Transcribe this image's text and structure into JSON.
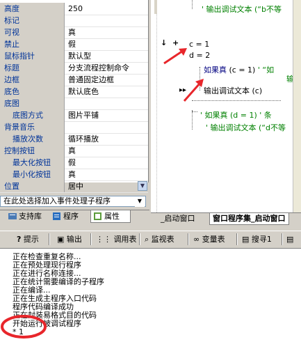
{
  "properties": [
    {
      "name": "高度",
      "value": "250",
      "sub": false
    },
    {
      "name": "标记",
      "value": "",
      "sub": false
    },
    {
      "name": "可视",
      "value": "真",
      "sub": false
    },
    {
      "name": "禁止",
      "value": "假",
      "sub": false
    },
    {
      "name": "鼠标指针",
      "value": "默认型",
      "sub": false
    },
    {
      "name": "标题",
      "value": "分支流程控制命令",
      "sub": false
    },
    {
      "name": "边框",
      "value": "普通固定边框",
      "sub": false
    },
    {
      "name": "底色",
      "value": "默认底色",
      "sub": false
    },
    {
      "name": "底图",
      "value": "",
      "sub": false
    },
    {
      "name": "底图方式",
      "value": "图片平铺",
      "sub": true
    },
    {
      "name": "背景音乐",
      "value": "",
      "sub": false
    },
    {
      "name": "播放次数",
      "value": "循环播放",
      "sub": true
    },
    {
      "name": "控制按钮",
      "value": "真",
      "sub": false
    },
    {
      "name": "最大化按钮",
      "value": "假",
      "sub": true
    },
    {
      "name": "最小化按钮",
      "value": "真",
      "sub": true
    },
    {
      "name": "位置",
      "value": "居中",
      "sub": false
    }
  ],
  "event_select": "在此处选择加入事件处理子程序",
  "left_tabs": [
    "支持库",
    "程序",
    "属性"
  ],
  "code": {
    "line_top": "' 输出调试文本 (“b不等",
    "line_c": "c = 1",
    "line_d": "d = 2",
    "if_kw": "如果真",
    "if_cond": "(c = 1)",
    "if_comment": "' “如",
    "if_comment2": "输出",
    "out_call": "输出调试文本 (c)",
    "comment_if2": "' 如果真 (d = 1) ' 条",
    "comment_out2": "' 输出调试文本 (“d不等",
    "plus": "+",
    "arrow_mark": "↓"
  },
  "code_tabs": [
    "_启动窗口",
    "窗口程序集_启动窗口"
  ],
  "toolbar": [
    "提示",
    "输出",
    "调用表",
    "监视表",
    "变量表",
    "搜寻1"
  ],
  "output_lines": [
    "正在检查重复名称...",
    "正在预处理现行程序",
    "正在进行名称连接...",
    "正在统计需要编译的子程序",
    "正在编译...",
    "正在生成主程序入口代码",
    "程序代码编译成功",
    "正在封装易格式目的代码",
    "开始运行被调试程序",
    "* 1"
  ],
  "colors": {
    "highlight_red": "#e8262b",
    "comment_green": "#008000",
    "keyword_blue": "#0000c0"
  }
}
